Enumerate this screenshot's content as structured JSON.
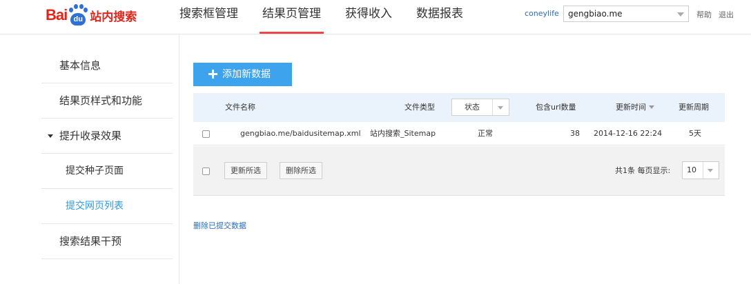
{
  "logo": {
    "bai": "Bai",
    "du": "du",
    "suffix": "站内搜索"
  },
  "nav": [
    {
      "label": "搜索框管理"
    },
    {
      "label": "结果页管理"
    },
    {
      "label": "获得收入"
    },
    {
      "label": "数据报表"
    }
  ],
  "header": {
    "username": "coneylife",
    "site_select": "gengbiao.me",
    "help": "帮助",
    "logout": "退出"
  },
  "sidebar": {
    "items": [
      {
        "label": "基本信息"
      },
      {
        "label": "结果页样式和功能"
      },
      {
        "label": "提升收录效果"
      },
      {
        "label": "提交种子页面"
      },
      {
        "label": "提交网页列表"
      },
      {
        "label": "搜索结果干预"
      }
    ]
  },
  "main": {
    "add_button": "添加新数据",
    "columns": {
      "file_name": "文件名称",
      "file_type": "文件类型",
      "status": "状态",
      "url_count": "包含url数量",
      "updated": "更新时间",
      "period": "更新周期"
    },
    "rows": [
      {
        "file_name": "gengbiao.me/baidusitemap.xml",
        "file_type": "站内搜索_Sitemap",
        "status": "正常",
        "url_count": "38",
        "updated": "2014-12-16 22:24",
        "period": "5天"
      }
    ],
    "footer": {
      "update_selected": "更新所选",
      "delete_selected": "删除所选",
      "pager_text": "共1条 每页显示:",
      "page_size": "10"
    },
    "delete_submitted_link": "删除已提交数据"
  },
  "colors": {
    "accent_blue": "#3ca3ec",
    "active_red": "#e9474a",
    "link_blue": "#2c6bb8",
    "active_side": "#2c9be0",
    "logo_red": "#e1251b",
    "logo_blue": "#2f6fd6"
  }
}
